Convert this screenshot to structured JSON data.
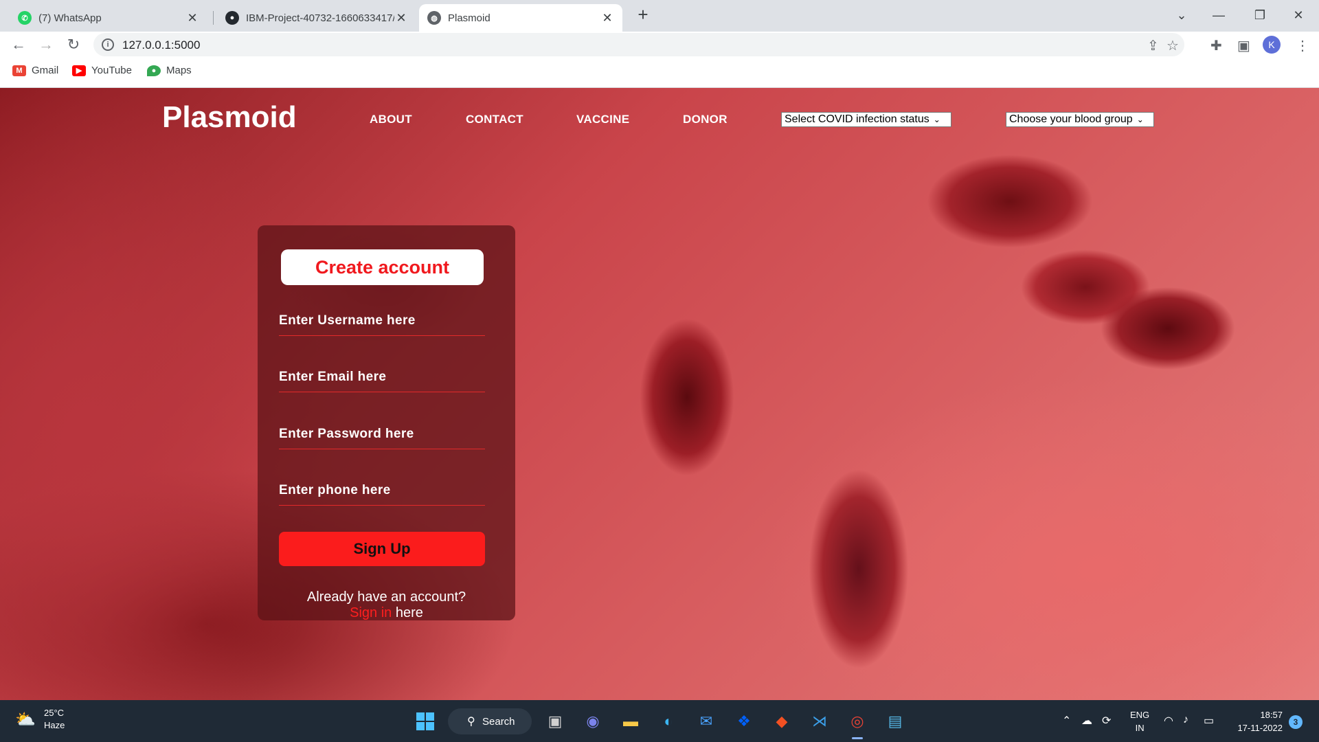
{
  "browser": {
    "tabs": [
      {
        "title": "(7) WhatsApp",
        "favicon": "whatsapp-icon",
        "color": "#25d366",
        "active": false
      },
      {
        "title": "IBM-Project-40732-1660633417/",
        "favicon": "github-icon",
        "color": "#24292f",
        "active": false
      },
      {
        "title": "Plasmoid",
        "favicon": "globe-icon",
        "color": "#5f6368",
        "active": true
      }
    ],
    "url": "127.0.0.1:5000",
    "profile_initial": "K",
    "bookmarks": [
      {
        "label": "Gmail",
        "icon": "gmail-icon"
      },
      {
        "label": "YouTube",
        "icon": "youtube-icon"
      },
      {
        "label": "Maps",
        "icon": "maps-icon"
      }
    ]
  },
  "page": {
    "brand": "Plasmoid",
    "nav": [
      "ABOUT",
      "CONTACT",
      "VACCINE",
      "DONOR"
    ],
    "covid_select": "Select COVID infection status",
    "blood_select": "Choose your blood group",
    "form": {
      "title": "Create account",
      "username_placeholder": "Enter Username here",
      "email_placeholder": "Enter Email here",
      "password_placeholder": "Enter Password here",
      "phone_placeholder": "Enter phone here",
      "submit_label": "Sign Up",
      "already_text": "Already have an account?",
      "signin_link": "Sign in",
      "signin_suffix": "here"
    },
    "colors": {
      "accent": "#fb1c1c",
      "title_text": "#f0191e"
    }
  },
  "taskbar": {
    "weather_temp": "25°C",
    "weather_desc": "Haze",
    "search_label": "Search",
    "lang_line1": "ENG",
    "lang_line2": "IN",
    "time": "18:57",
    "date": "17-11-2022",
    "notifications": "3"
  }
}
